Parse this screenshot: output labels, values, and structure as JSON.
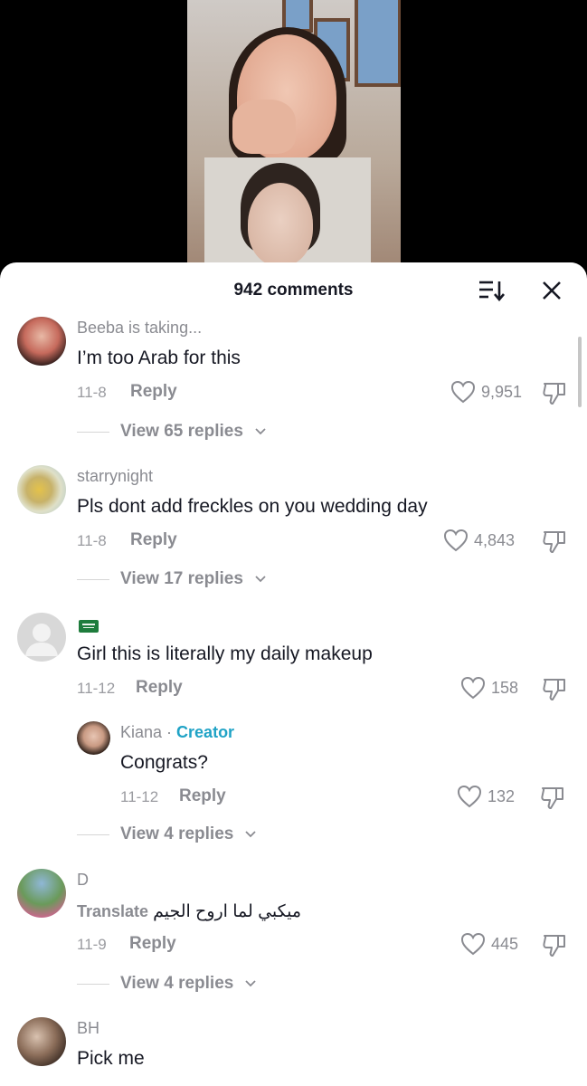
{
  "header": {
    "comment_count": "942 comments"
  },
  "comments": [
    {
      "user": "Beeba is taking...",
      "text": "I’m too Arab for this",
      "date": "11-8",
      "reply_label": "Reply",
      "likes": "9,951",
      "view_replies": "View 65 replies"
    },
    {
      "user": "starrynight",
      "text": "Pls dont add freckles on you wedding day",
      "date": "11-8",
      "reply_label": "Reply",
      "likes": "4,843",
      "view_replies": "View 17 replies"
    },
    {
      "user": "",
      "text": "Girl this is literally my daily makeup",
      "date": "11-12",
      "reply_label": "Reply",
      "likes": "158",
      "view_replies": "View 4 replies",
      "reply": {
        "user": "Kiana",
        "separator": " · ",
        "creator_label": "Creator",
        "text": "Congrats?",
        "date": "11-12",
        "reply_label": "Reply",
        "likes": "132"
      }
    },
    {
      "user": "D",
      "translate_label": "Translate",
      "text": "ميكبي لما اروح الجيم",
      "date": "11-9",
      "reply_label": "Reply",
      "likes": "445",
      "view_replies": "View 4 replies"
    },
    {
      "user": "BH",
      "text": "Pick me"
    }
  ],
  "colors": {
    "creator": "#20a3c6",
    "text": "#161823",
    "muted": "#8a8b91"
  },
  "icons": [
    "sort-icon",
    "close-icon",
    "heart-icon",
    "dislike-icon",
    "chevron-down-icon",
    "default-avatar-icon",
    "saudi-flag-icon"
  ]
}
